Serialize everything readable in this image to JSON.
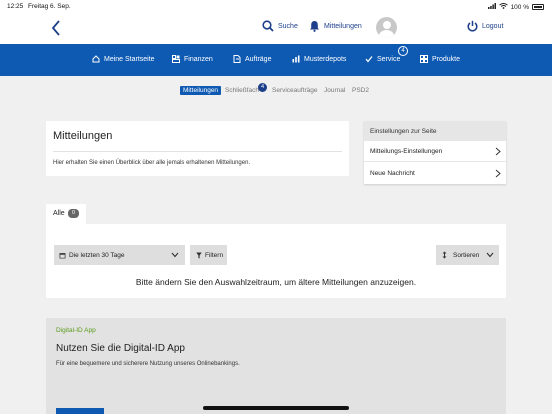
{
  "status_bar": {
    "time": "12:25",
    "date": "Freitag 6. Sep.",
    "battery": "100 %"
  },
  "header": {
    "search_label": "Suche",
    "messages_label": "Mitteilungen",
    "logout_label": "Logout"
  },
  "nav": {
    "items": [
      {
        "label": "Meine Startseite",
        "icon": "home-icon"
      },
      {
        "label": "Finanzen",
        "icon": "finance-icon"
      },
      {
        "label": "Aufträge",
        "icon": "orders-icon"
      },
      {
        "label": "Musterdepots",
        "icon": "chart-icon"
      },
      {
        "label": "Service",
        "icon": "check-icon",
        "badge": "4"
      },
      {
        "label": "Produkte",
        "icon": "grid-icon"
      }
    ]
  },
  "subtabs": {
    "items": [
      {
        "label": "Mitteilungen",
        "active": true
      },
      {
        "label": "Schließfach",
        "badge": "4"
      },
      {
        "label": "Serviceaufträge"
      },
      {
        "label": "Journal"
      },
      {
        "label": "PSD2"
      }
    ]
  },
  "intro": {
    "title": "Mitteilungen",
    "text": "Hier erhalten Sie einen Überblick über alle jemals erhaltenen Mitteilungen."
  },
  "settings": {
    "header": "Einstellungen zur Seite",
    "items": [
      {
        "label": "Mitteilungs-Einstellungen"
      },
      {
        "label": "Neue Nachricht"
      }
    ]
  },
  "messages": {
    "tab_label": "Alle",
    "tab_count": "0",
    "period_value": "Die letzten 30 Tage",
    "filter_label": "Filtern",
    "sort_label": "Sortieren",
    "empty_text": "Bitte ändern Sie den Auswahlzeitraum, um ältere Mitteilungen anzuzeigen."
  },
  "digital_id": {
    "label": "Digital-ID App",
    "title": "Nutzen Sie die Digital-ID App",
    "text": "Für eine bequemere und sicherere Nutzung unseres Onlinebankings."
  },
  "colors": {
    "brand_blue": "#0e5ab3",
    "dark_blue": "#1d3f8a",
    "green_label": "#5a9a1a"
  }
}
